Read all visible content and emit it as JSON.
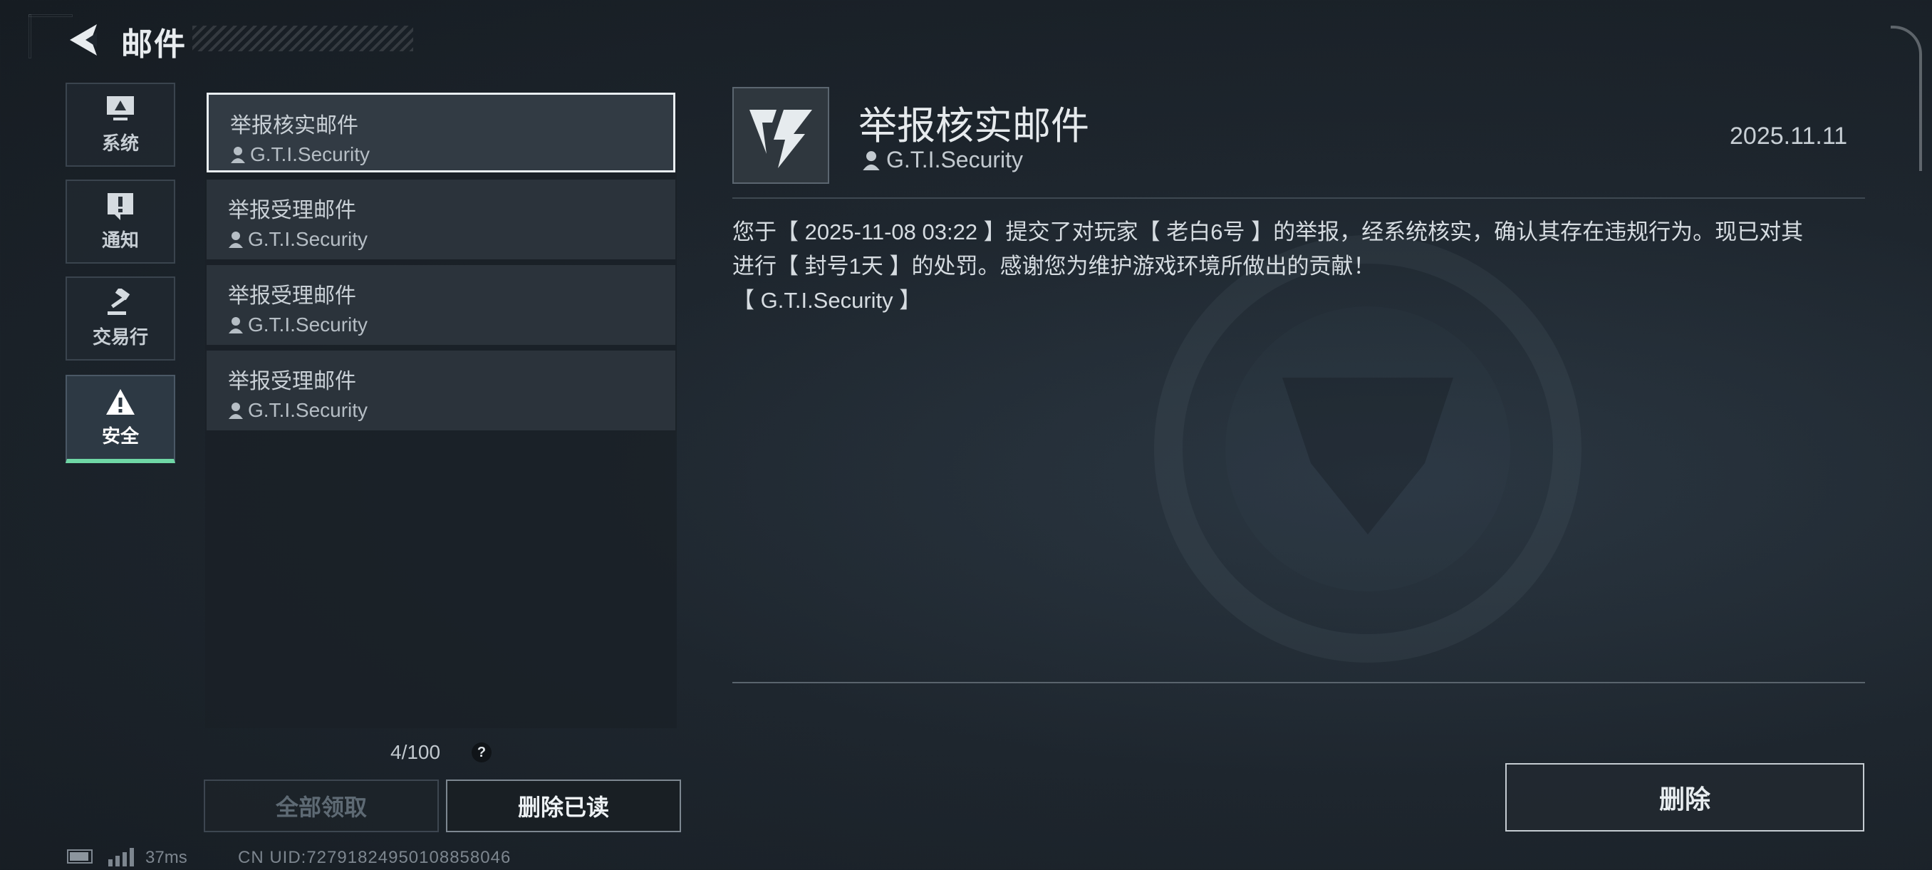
{
  "header": {
    "title": "邮件"
  },
  "categories": [
    {
      "label": "系统",
      "icon": "monitor-icon"
    },
    {
      "label": "通知",
      "icon": "exclamation-icon"
    },
    {
      "label": "交易行",
      "icon": "gavel-icon"
    },
    {
      "label": "安全",
      "icon": "warning-icon",
      "active": true
    }
  ],
  "mails": [
    {
      "title": "举报核实邮件",
      "sender": "G.T.I.Security",
      "selected": true
    },
    {
      "title": "举报受理邮件",
      "sender": "G.T.I.Security"
    },
    {
      "title": "举报受理邮件",
      "sender": "G.T.I.Security"
    },
    {
      "title": "举报受理邮件",
      "sender": "G.T.I.Security"
    }
  ],
  "mail_count": "4/100",
  "help": "?",
  "buttons": {
    "claim_all": "全部领取",
    "delete_read": "删除已读",
    "delete": "删除"
  },
  "status": {
    "ping": "37ms",
    "uid": "CN UID:72791824950108858046"
  },
  "detail": {
    "title": "举报核实邮件",
    "sender": "G.T.I.Security",
    "date": "2025.11.11",
    "body_line1": "您于【 2025-11-08 03:22 】提交了对玩家【 老白6号 】的举报，经系统核实，确认其存在违规行为。现已对其",
    "body_line2": "进行【 封号1天 】的处罚。感谢您为维护游戏环境所做出的贡献！",
    "body_line3": "【 G.T.I.Security 】"
  },
  "colors": {
    "accent": "#6fd7a5",
    "background": "#1e262e",
    "selected_border": "#e9eef2"
  }
}
